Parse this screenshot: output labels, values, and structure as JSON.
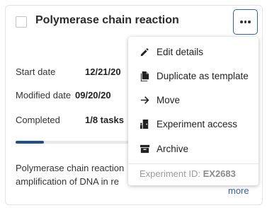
{
  "card": {
    "title": "Polymerase chain reaction",
    "fields": [
      {
        "label": "Start date",
        "value": "12/21/20"
      },
      {
        "label": "Modified date",
        "value": "09/20/20"
      },
      {
        "label": "Completed",
        "value": "1/8 tasks"
      }
    ],
    "progress_fraction": 0.125,
    "description_lines": [
      "Polymerase chain reaction",
      "amplification of DNA in re"
    ],
    "more_link": "more"
  },
  "menu": {
    "items": [
      {
        "label": "Edit details",
        "icon": "pencil-icon"
      },
      {
        "label": "Duplicate as template",
        "icon": "duplicate-icon"
      },
      {
        "label": "Move",
        "icon": "arrow-right-icon"
      },
      {
        "label": "Experiment access",
        "icon": "door-access-icon"
      },
      {
        "label": "Archive",
        "icon": "archive-box-icon"
      }
    ],
    "experiment_id_label": "Experiment ID:",
    "experiment_id_value": "EX2683"
  },
  "colors": {
    "accent": "#2e63b0",
    "progress": "#1f4f91",
    "muted": "#9a9a9a"
  }
}
